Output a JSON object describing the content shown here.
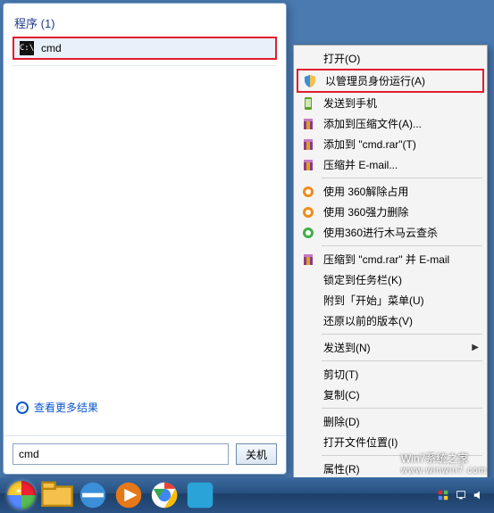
{
  "startmenu": {
    "section": "程序 (1)",
    "result": {
      "label": "cmd"
    },
    "more": "查看更多结果",
    "search_value": "cmd",
    "shutdown": "关机"
  },
  "context_menu": {
    "items": [
      {
        "label": "打开(O)",
        "icon": "open",
        "arrow": false
      },
      {
        "label": "以管理员身份运行(A)",
        "icon": "shield",
        "arrow": false,
        "highlight": true
      },
      {
        "label": "发送到手机",
        "icon": "phone",
        "arrow": false
      },
      {
        "label": "添加到压缩文件(A)...",
        "icon": "rar",
        "arrow": false
      },
      {
        "label": "添加到 \"cmd.rar\"(T)",
        "icon": "rar",
        "arrow": false
      },
      {
        "label": "压缩并 E-mail...",
        "icon": "rar",
        "arrow": false
      },
      {
        "sep": true
      },
      {
        "label": "使用 360解除占用",
        "icon": "360-orange",
        "arrow": false
      },
      {
        "label": "使用 360强力删除",
        "icon": "360-orange",
        "arrow": false
      },
      {
        "label": "使用360进行木马云查杀",
        "icon": "360-green",
        "arrow": false
      },
      {
        "sep": true
      },
      {
        "label": "压缩到 \"cmd.rar\" 并 E-mail",
        "icon": "rar",
        "arrow": false
      },
      {
        "label": "锁定到任务栏(K)",
        "icon": "",
        "arrow": false
      },
      {
        "label": "附到「开始」菜单(U)",
        "icon": "",
        "arrow": false
      },
      {
        "label": "还原以前的版本(V)",
        "icon": "",
        "arrow": false
      },
      {
        "sep": true
      },
      {
        "label": "发送到(N)",
        "icon": "",
        "arrow": true
      },
      {
        "sep": true
      },
      {
        "label": "剪切(T)",
        "icon": "",
        "arrow": false
      },
      {
        "label": "复制(C)",
        "icon": "",
        "arrow": false
      },
      {
        "sep": true
      },
      {
        "label": "删除(D)",
        "icon": "",
        "arrow": false
      },
      {
        "label": "打开文件位置(I)",
        "icon": "",
        "arrow": false
      },
      {
        "sep": true
      },
      {
        "label": "属性(R)",
        "icon": "",
        "arrow": false
      }
    ]
  },
  "watermark": {
    "line1": "Win7系统之家",
    "line2": "www.winwin7.com"
  },
  "colors": {
    "highlight_border": "#e11d2c"
  }
}
